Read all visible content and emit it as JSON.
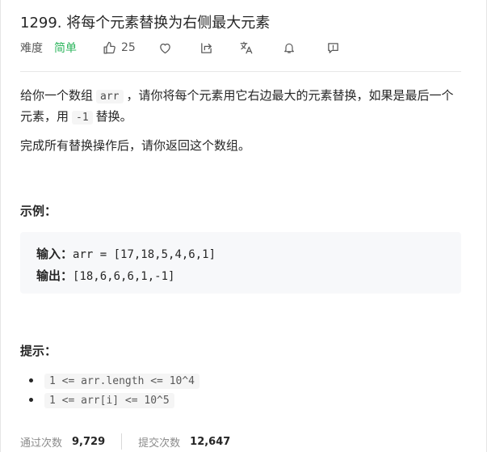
{
  "problem": {
    "title": "1299. 将每个元素替换为右侧最大元素",
    "difficulty_label": "难度",
    "difficulty_value": "简单",
    "likes": "25"
  },
  "description": {
    "p1_before": "给你一个数组",
    "p1_code1": "arr",
    "p1_middle": "，请你将每个元素用它右边最大的元素替换，如果是最后一个元素，用",
    "p1_code2": "-1",
    "p1_after": "替换。",
    "p2": "完成所有替换操作后，请你返回这个数组。"
  },
  "example": {
    "section_title": "示例：",
    "input_label": "输入：",
    "input_value": "arr = [17,18,5,4,6,1]",
    "output_label": "输出：",
    "output_value": "[18,6,6,6,1,-1]"
  },
  "hints": {
    "section_title": "提示：",
    "items": [
      "1 <= arr.length <= 10^4",
      "1 <= arr[i] <= 10^5"
    ]
  },
  "stats": {
    "accepted_label": "通过次数",
    "accepted_value": "9,729",
    "submitted_label": "提交次数",
    "submitted_value": "12,647"
  },
  "icons": {
    "like": "thumbs-up-icon",
    "favorite": "heart-icon",
    "share": "share-icon",
    "translate": "translate-icon",
    "notify": "bell-icon",
    "feedback": "feedback-icon"
  },
  "colors": {
    "easy": "#2db55d",
    "text": "#262626",
    "muted": "#8c8c8c"
  }
}
